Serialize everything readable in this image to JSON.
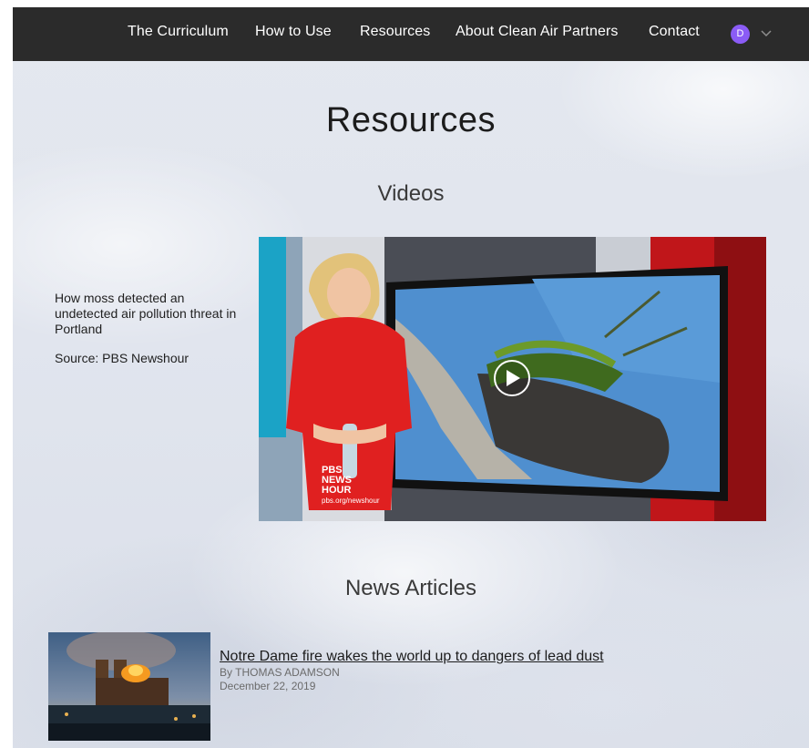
{
  "nav": {
    "items": [
      "The Curriculum",
      "How to Use",
      "Resources",
      "About Clean Air Partners",
      "Contact"
    ],
    "avatar_initial": "D"
  },
  "page": {
    "title": "Resources",
    "videos_heading": "Videos",
    "news_heading": "News Articles"
  },
  "video": {
    "description": "How moss detected an undetected air pollution threat in Portland",
    "source": "Source: PBS Newshour",
    "logo_line1": "PBS",
    "logo_line2": "NEWS",
    "logo_line3": "HOUR",
    "logo_url": "pbs.org/newshour"
  },
  "article": {
    "title": "Notre Dame fire wakes the world up to dangers of lead dust",
    "byline": "By THOMAS ADAMSON",
    "date": "December 22, 2019"
  },
  "colors": {
    "topbar": "#2b2b2b",
    "avatar": "#8b5cf6",
    "text": "#1c1c1c"
  }
}
